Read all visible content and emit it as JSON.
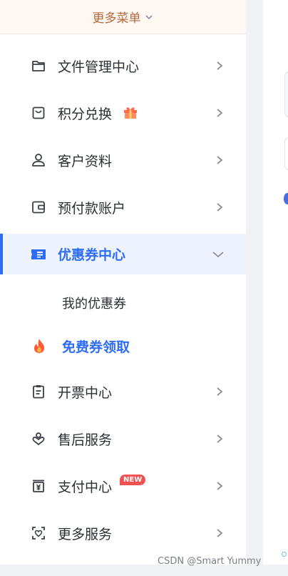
{
  "more_menu": {
    "label": "更多菜单",
    "icon": "chevron-down-icon"
  },
  "menu": {
    "file_center": {
      "label": "文件管理中心",
      "icon": "folder-icon"
    },
    "points": {
      "label": "积分兑换",
      "icon": "shopping-bag-icon",
      "extra_icon": "gift-icon"
    },
    "customer": {
      "label": "客户资料",
      "icon": "user-icon"
    },
    "prepaid": {
      "label": "预付款账户",
      "icon": "wallet-icon"
    },
    "coupon": {
      "label": "优惠券中心",
      "icon": "ticket-icon",
      "expanded": true
    },
    "coupon_sub": {
      "label": "我的优惠券"
    },
    "free_coupon": {
      "label": "免费券领取",
      "icon": "fire-icon"
    },
    "invoice": {
      "label": "开票中心",
      "icon": "clipboard-icon"
    },
    "after_sales": {
      "label": "售后服务",
      "icon": "service-icon"
    },
    "payment": {
      "label": "支付中心",
      "icon": "cashier-icon",
      "badge": "NEW"
    },
    "more_services": {
      "label": "更多服务",
      "icon": "scan-heart-icon"
    }
  },
  "colors": {
    "accent": "#2f6cf6",
    "badge": "#f05252",
    "more_menu_text": "#b36a3c"
  },
  "watermark": "CSDN @Smart Yummy"
}
